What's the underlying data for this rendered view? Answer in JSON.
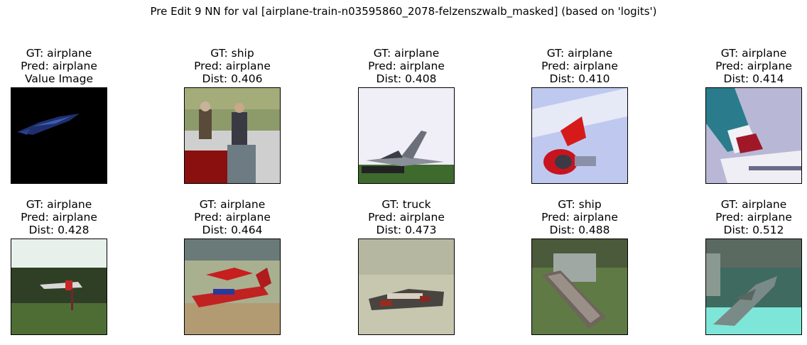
{
  "title": "Pre Edit 9 NN for val [airplane-train-n03595860_2078-felzenszwalb_masked] (based on 'logits')",
  "chart_data": {
    "type": "image_grid",
    "title": "Pre Edit 9 NN for val [airplane-train-n03595860_2078-felzenszwalb_masked] (based on 'logits')",
    "panels": [
      {
        "gt": "GT: airplane",
        "pred": "Pred: airplane",
        "third": "Value Image",
        "thumb": "masked-airplane"
      },
      {
        "gt": "GT: ship",
        "pred": "Pred: airplane",
        "third": "Dist: 0.406",
        "dist": 0.406,
        "thumb": "people-field"
      },
      {
        "gt": "GT: airplane",
        "pred": "Pred: airplane",
        "third": "Dist: 0.408",
        "dist": 0.408,
        "thumb": "jet-sky"
      },
      {
        "gt": "GT: airplane",
        "pred": "Pred: airplane",
        "third": "Dist: 0.410",
        "dist": 0.41,
        "thumb": "airliner-engine"
      },
      {
        "gt": "GT: airplane",
        "pred": "Pred: airplane",
        "third": "Dist: 0.414",
        "dist": 0.414,
        "thumb": "tail-fin"
      },
      {
        "gt": "GT: airplane",
        "pred": "Pred: airplane",
        "third": "Dist: 0.428",
        "dist": 0.428,
        "thumb": "plane-over-field"
      },
      {
        "gt": "GT: airplane",
        "pred": "Pred: airplane",
        "third": "Dist: 0.464",
        "dist": 0.464,
        "thumb": "red-biplane"
      },
      {
        "gt": "GT: truck",
        "pred": "Pred: airplane",
        "third": "Dist: 0.473",
        "dist": 0.473,
        "thumb": "toy-vehicle"
      },
      {
        "gt": "GT: ship",
        "pred": "Pred: airplane",
        "third": "Dist: 0.488",
        "dist": 0.488,
        "thumb": "boat-on-grass"
      },
      {
        "gt": "GT: airplane",
        "pred": "Pred: airplane",
        "third": "Dist: 0.512",
        "dist": 0.512,
        "thumb": "plane-model-teal"
      }
    ]
  }
}
